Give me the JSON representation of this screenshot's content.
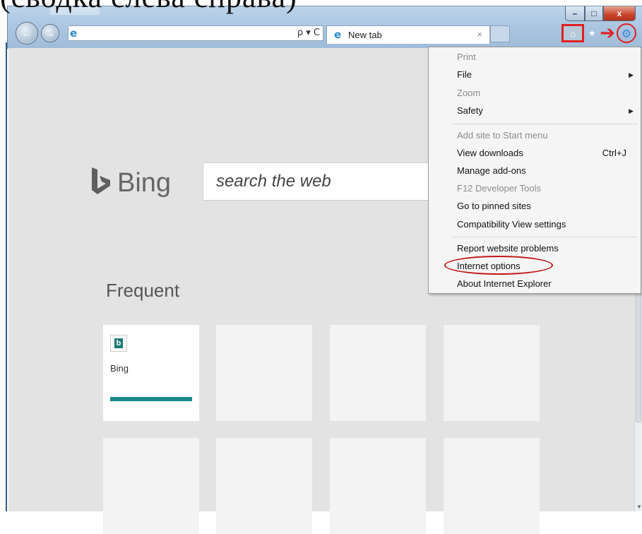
{
  "caption": {
    "text": "(сводка слева справа)"
  },
  "window": {
    "min_label": "–",
    "max_label": "□",
    "close_label": "x"
  },
  "address_bar": {
    "value": "",
    "tools": "ρ ▾ C"
  },
  "tab": {
    "title": "New tab",
    "close": "×"
  },
  "icons": {
    "back": "back-arrow-icon",
    "forward": "forward-arrow-icon",
    "home": "home-icon",
    "favorites": "star-icon",
    "tools": "gear-icon",
    "colors": {
      "annotation": "#e02020",
      "bing_teal": "#1a8a86"
    }
  },
  "page": {
    "bing_word": "Bing",
    "search_placeholder": "search the web",
    "frequent_title": "Frequent",
    "tiles": [
      {
        "label": "Bing"
      }
    ]
  },
  "menu": {
    "items": [
      {
        "label": "Print",
        "disabled": true
      },
      {
        "label": "File",
        "submenu": true
      },
      {
        "label": "Zoom",
        "disabled": true
      },
      {
        "label": "Safety",
        "submenu": true
      },
      {
        "label": "Add site to Start menu",
        "disabled": true
      },
      {
        "label": "View downloads",
        "shortcut": "Ctrl+J"
      },
      {
        "label": "Manage add-ons"
      },
      {
        "label": "F12 Developer Tools",
        "disabled": true
      },
      {
        "label": "Go to pinned sites"
      },
      {
        "label": "Compatibility View settings"
      },
      {
        "label": "Report website problems"
      },
      {
        "label": "Internet options",
        "highlighted": true
      },
      {
        "label": "About Internet Explorer"
      }
    ],
    "submenu_arrow": "▶"
  }
}
